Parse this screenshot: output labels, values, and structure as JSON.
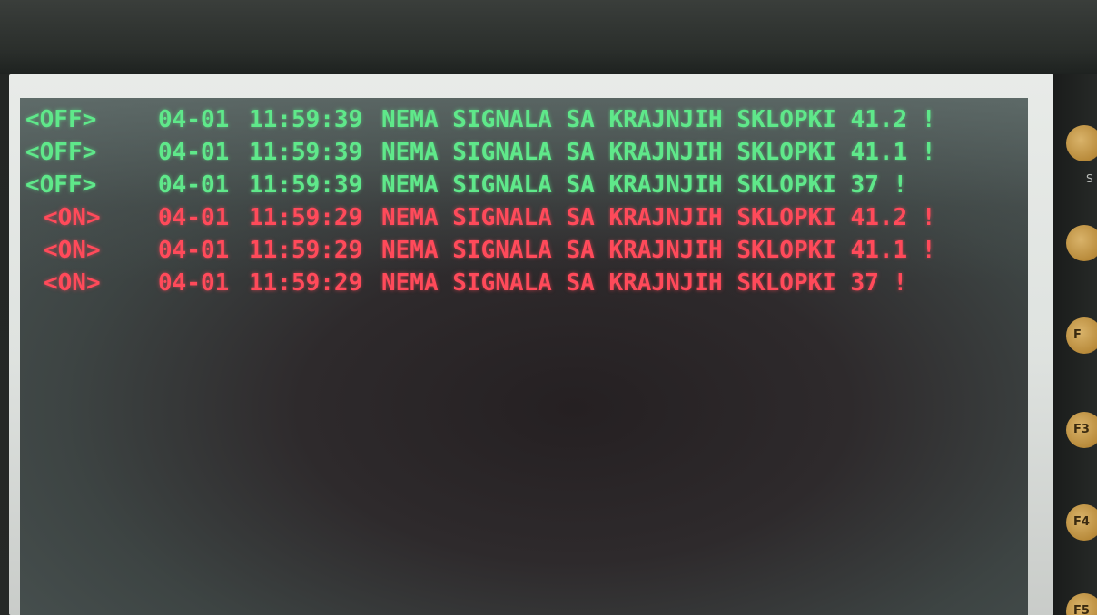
{
  "alarms": [
    {
      "state": "<OFF>",
      "date": "04-01",
      "time": "11:59:39",
      "message": "NEMA SIGNALA SA KRAJNJIH SKLOPKI 41.2 !",
      "status": "off"
    },
    {
      "state": "<OFF>",
      "date": "04-01",
      "time": "11:59:39",
      "message": "NEMA SIGNALA SA KRAJNJIH SKLOPKI 41.1 !",
      "status": "off"
    },
    {
      "state": "<OFF>",
      "date": "04-01",
      "time": "11:59:39",
      "message": "NEMA SIGNALA SA KRAJNJIH SKLOPKI 37 !",
      "status": "off"
    },
    {
      "state": "<ON>",
      "date": "04-01",
      "time": "11:59:29",
      "message": "NEMA SIGNALA SA KRAJNJIH SKLOPKI 41.2 !",
      "status": "on"
    },
    {
      "state": "<ON>",
      "date": "04-01",
      "time": "11:59:29",
      "message": "NEMA SIGNALA SA KRAJNJIH SKLOPKI 41.1 !",
      "status": "on"
    },
    {
      "state": "<ON>",
      "date": "04-01",
      "time": "11:59:29",
      "message": "NEMA SIGNALA SA KRAJNJIH SKLOPKI 37 !",
      "status": "on"
    }
  ],
  "colors": {
    "off_text": "#5fe88a",
    "on_text": "#ff4a5a"
  },
  "keypad": {
    "side_label": "S",
    "keys": [
      "",
      "",
      "F",
      "F3",
      "F4",
      "F5"
    ]
  }
}
